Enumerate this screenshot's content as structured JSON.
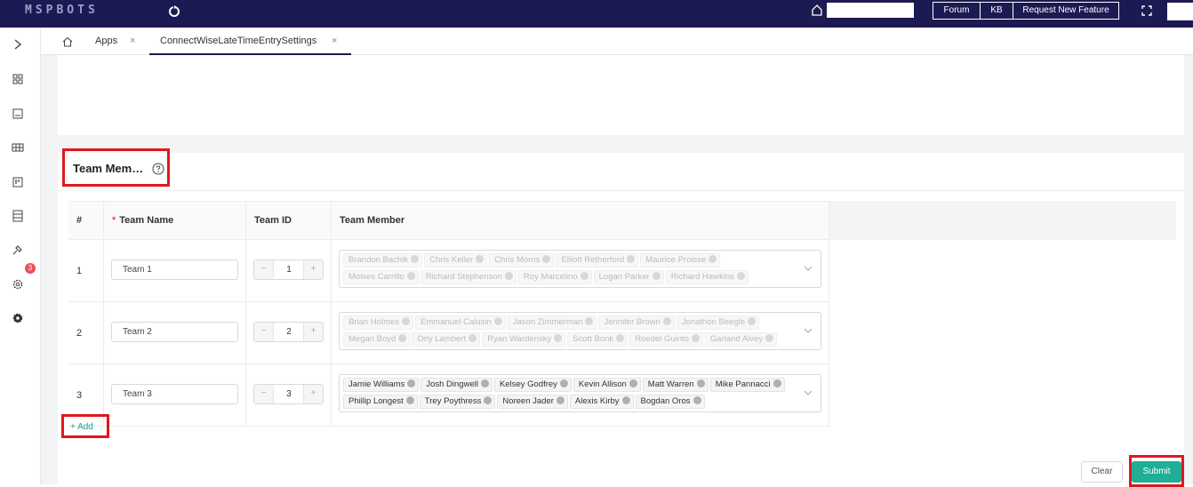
{
  "topbar": {
    "logo": "MSPBOTS",
    "search_value": "",
    "buttons": [
      "Forum",
      "KB",
      "Request New Feature"
    ]
  },
  "sidebar": {
    "icons": [
      "expand-chevron-icon",
      "dashboard-grid-icon",
      "report-icon",
      "table-icon",
      "kanban-icon",
      "dataset-icon",
      "bot-icon",
      "settings-gear-icon",
      "admin-gear-icon"
    ],
    "badge_count": "3"
  },
  "tabs": {
    "items": [
      {
        "label": "Apps",
        "close": "×"
      },
      {
        "label": "ConnectWiseLateTimeEntrySettings",
        "close": "×"
      }
    ]
  },
  "section": {
    "title": "Team Mem…"
  },
  "table": {
    "headers": {
      "num": "#",
      "required_mark": "*",
      "name": "Team Name",
      "id": "Team ID",
      "member": "Team Member"
    },
    "rows": [
      {
        "num": "1",
        "name": "Team 1",
        "id": "1",
        "minus": "−",
        "plus": "+",
        "members": [
          "Brandon Bachik",
          "Chris Keller",
          "Chris Morris",
          "Elliott Retherford",
          "Maurice Proisse",
          "Moises Carrillo",
          "Richard Stephenson",
          "Roy Marcelino",
          "Logan Parker",
          "Richard Hawkins"
        ]
      },
      {
        "num": "2",
        "name": "Team 2",
        "id": "2",
        "minus": "−",
        "plus": "+",
        "members": [
          "Brian Holmes",
          "Emmanuel Calusin",
          "Jason Zimmerman",
          "Jennifer Brown",
          "Jonathon Beegle",
          "Megan Boyd",
          "Orly Lambert",
          "Ryan Wardensky",
          "Scott Bonk",
          "Roedel Guinto",
          "Garland Alvey"
        ]
      },
      {
        "num": "3",
        "name": "Team 3",
        "id": "3",
        "minus": "−",
        "plus": "+",
        "members": [
          "Jamie Williams",
          "Josh Dingwell",
          "Kelsey Godfrey",
          "Kevin Allison",
          "Matt Warren",
          "Mike Pannacci",
          "Phillip Longest",
          "Trey Poythress",
          "Noreen Jader",
          "Alexis Kirby",
          "Bogdan Oros"
        ]
      }
    ]
  },
  "actions": {
    "add": "+ Add",
    "clear": "Clear",
    "submit": "Submit"
  },
  "colors": {
    "topbar": "#1c1a52",
    "accent": "#1fae96",
    "highlight": "#e0181e"
  }
}
